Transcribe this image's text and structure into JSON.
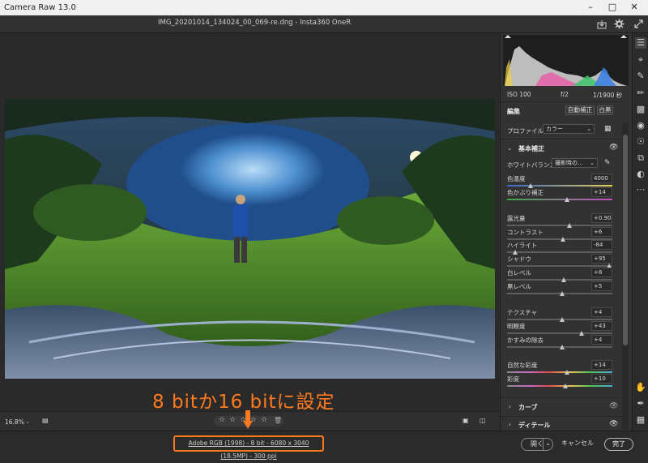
{
  "app": {
    "title": "Camera Raw 13.0"
  },
  "document": {
    "filename": "IMG_20201014_134024_00_069-re.dng  -  Insta360 OneR"
  },
  "histogram": {
    "iso": "ISO 100",
    "aperture": "f/2",
    "shutter": "1/1900 秒"
  },
  "edit": {
    "title": "編集",
    "auto_label": "自動補正",
    "bw_label": "白黒",
    "profile_label": "プロファイル",
    "profile_value": "カラー"
  },
  "basic": {
    "title": "基本補正",
    "wb_label": "ホワイトバランス",
    "wb_value": "撮影時の...",
    "sliders": [
      {
        "label": "色温度",
        "value": "4000",
        "pos": 0.22
      },
      {
        "label": "色かぶり補正",
        "value": "+14",
        "pos": 0.57
      },
      {
        "label": "露光量",
        "value": "+0.90",
        "pos": 0.59
      },
      {
        "label": "コントラスト",
        "value": "+6",
        "pos": 0.53
      },
      {
        "label": "ハイライト",
        "value": "-84",
        "pos": 0.08
      },
      {
        "label": "シャドウ",
        "value": "+95",
        "pos": 0.97
      },
      {
        "label": "白レベル",
        "value": "+8",
        "pos": 0.54
      },
      {
        "label": "黒レベル",
        "value": "+5",
        "pos": 0.52
      },
      {
        "label": "テクスチャ",
        "value": "+4",
        "pos": 0.52
      },
      {
        "label": "明瞭度",
        "value": "+43",
        "pos": 0.71
      },
      {
        "label": "かすみの除去",
        "value": "+4",
        "pos": 0.52
      },
      {
        "label": "自然な彩度",
        "value": "+14",
        "pos": 0.57
      },
      {
        "label": "彩度",
        "value": "+10",
        "pos": 0.55
      }
    ]
  },
  "sections": {
    "curve": "カーブ",
    "detail": "ディテール"
  },
  "canvas": {
    "zoom": "16.8%"
  },
  "annotation": {
    "text": "8 bitか16 bitに設定"
  },
  "status": {
    "workflow_info": "Adobe RGB (1998) - 8 bit - 6080 x 3040 (18.5MP) - 300 ppi",
    "open_label": "開く",
    "cancel_label": "キャンセル",
    "done_label": "完了"
  },
  "colors": {
    "accent": "#ff7a1e",
    "panel_bg": "#323232"
  },
  "icons": [
    "minimize-icon",
    "maximize-icon",
    "close-icon",
    "export-icon",
    "gear-icon",
    "fullscreen-icon",
    "edit-icon",
    "crop-icon",
    "heal-icon",
    "brush-icon",
    "gradient-icon",
    "radial-icon",
    "redeye-icon",
    "snapshots-icon",
    "presets-icon",
    "more-icon",
    "hand-icon",
    "eyedropper-icon",
    "grid-icon"
  ]
}
